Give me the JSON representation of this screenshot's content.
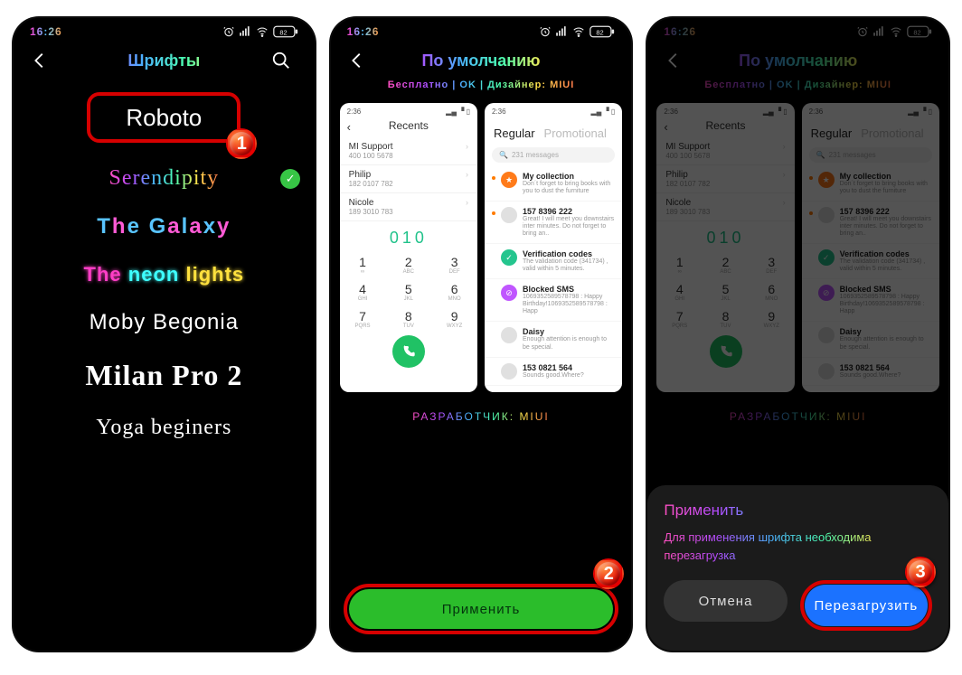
{
  "status": {
    "time": "16:26",
    "battery": "82"
  },
  "screen1": {
    "title": "Шрифты",
    "fonts": {
      "roboto": "Roboto",
      "serendipity": "Serendipity",
      "galaxy": "The Galaxy",
      "neon": "The neon lights",
      "moby": "Moby Begonia",
      "milan": "Milan Pro 2",
      "yoga": "Yoga beginers"
    },
    "badge": "1"
  },
  "screen2": {
    "title": "По умолчанию",
    "meta": "Бесплатно  |  OK  |  Дизайнер: MIUI",
    "preview_recents": {
      "time": "2:36",
      "title": "Recents",
      "items": [
        {
          "name": "MI Support",
          "sub": "400 100 5678"
        },
        {
          "name": "Philip",
          "sub": "182 0107 782"
        },
        {
          "name": "Nicole",
          "sub": "189 3010 783"
        }
      ],
      "dial_display": "010",
      "dial_keys": [
        {
          "n": "1",
          "l": "∞"
        },
        {
          "n": "2",
          "l": "ABC"
        },
        {
          "n": "3",
          "l": "DEF"
        },
        {
          "n": "4",
          "l": "GHI"
        },
        {
          "n": "5",
          "l": "JKL"
        },
        {
          "n": "6",
          "l": "MNO"
        },
        {
          "n": "7",
          "l": "PQRS"
        },
        {
          "n": "8",
          "l": "TUV"
        },
        {
          "n": "9",
          "l": "WXYZ"
        }
      ]
    },
    "preview_messages": {
      "time": "2:36",
      "tab_regular": "Regular",
      "tab_promo": "Promotional",
      "search_placeholder": "231 messages",
      "items": [
        {
          "dot": true,
          "color": "#ff7b1a",
          "icon": "★",
          "title": "My collection",
          "sub": "Don´t forget to bring books with you to dust the furniture"
        },
        {
          "dot": true,
          "color": "#e0e0e0",
          "icon": "",
          "title": "157 8396 222",
          "sub": "Great! I will meet you downstairs inter minutes. Do not forget to bring an.."
        },
        {
          "dot": false,
          "color": "#24c58e",
          "icon": "✓",
          "title": "Verification codes",
          "sub": "The validation code (341734) , valid within 5 minutes."
        },
        {
          "dot": false,
          "color": "#c056ff",
          "icon": "⊘",
          "title": "Blocked SMS",
          "sub": "1069352589578798 : Happy Birthday!1069352589578798 : Happ"
        },
        {
          "dot": false,
          "color": "#e0e0e0",
          "icon": "",
          "title": "Daisy",
          "sub": "Enough attention is enough to be special."
        },
        {
          "dot": false,
          "color": "#e0e0e0",
          "icon": "",
          "title": "153 0821 564",
          "sub": "Sounds good.Where?"
        }
      ]
    },
    "developer_label": "РАЗРАБОТЧИК:",
    "developer_value": "MIUI",
    "apply_label": "Применить",
    "badge": "2"
  },
  "screen3": {
    "sheet_title": "Применить",
    "sheet_text": "Для применения шрифта необходима перезагрузка",
    "cancel": "Отмена",
    "reboot": "Перезагрузить",
    "badge": "3"
  }
}
